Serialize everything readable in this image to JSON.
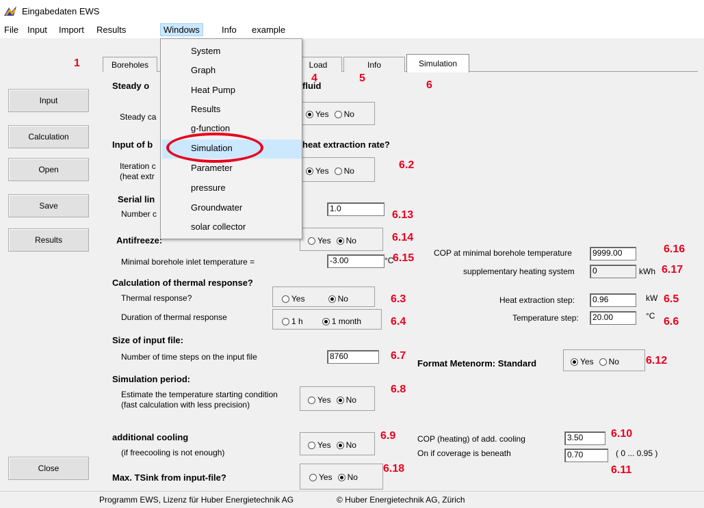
{
  "window": {
    "title": "Eingabedaten EWS"
  },
  "menubar": [
    "File",
    "Input",
    "Import",
    "Results",
    "Windows",
    "Info",
    "example"
  ],
  "windows_menu": [
    "System",
    "Graph",
    "Heat Pump",
    "Results",
    "g-function",
    "Simulation",
    "Parameter",
    "pressure",
    "Groundwater",
    "solar collector"
  ],
  "sidebar": {
    "input": "Input",
    "calculation": "Calculation",
    "open": "Open",
    "save": "Save",
    "results": "Results",
    "close": "Close"
  },
  "tabs": {
    "boreholes": "Boreholes",
    "load": "Load",
    "info": "Info",
    "simulation": "Simulation"
  },
  "annotations": {
    "n1": "1",
    "n4": "4",
    "n5": "5",
    "n6": "6",
    "a62": "6.2",
    "a613": "6.13",
    "a614": "6.14",
    "a615": "6.15",
    "a616": "6.16",
    "a617": "6.17",
    "a63": "6.3",
    "a64": "6.4",
    "a65": "6.5",
    "a66": "6.6",
    "a67": "6.7",
    "a612": "6.12",
    "a68": "6.8",
    "a69": "6.9",
    "a610": "6.10",
    "a611": "6.11",
    "a618": "6.18"
  },
  "simulation": {
    "steady_heading_left": "Steady o",
    "steady_heading_right": "fluid",
    "steady_label": "Steady ca",
    "input_heading_left": "Input of b",
    "input_heading_right": "heat extraction rate?",
    "iteration_label_1": "Iteration c",
    "iteration_label_2": "(heat extr",
    "serial_heading": "Serial lin",
    "number_label": "Number c",
    "number_value": "1.0",
    "antifreeze_heading": "Antifreeze:",
    "min_inlet_label": "Minimal borehole inlet temperature =",
    "min_inlet_value": "-3.00",
    "min_inlet_unit": "°C",
    "cop_min_label": "COP at minimal borehole temperature",
    "cop_min_value": "9999.00",
    "supp_label": "supplementary heating system",
    "supp_value": "0",
    "supp_unit": "kWh",
    "thermal_heading": "Calculation of thermal response?",
    "thermal_label": "Thermal response?",
    "duration_label": "Duration of thermal response",
    "opt_1h": "1 h",
    "opt_1month": "1 month",
    "heat_step_label": "Heat extraction step:",
    "heat_step_value": "0.96",
    "heat_step_unit": "kW",
    "temp_step_label": "Temperature step:",
    "temp_step_value": "20.00",
    "temp_step_unit": "°C",
    "size_heading": "Size of input file:",
    "steps_label": "Number of time steps on the input file",
    "steps_value": "8760",
    "metenorm_label": "Format Metenorm: Standard",
    "sim_period_heading": "Simulation period:",
    "estimate_label_1": "Estimate the temperature starting condition",
    "estimate_label_2": "(fast calculation with less precision)",
    "cooling_heading": "additional cooling",
    "cooling_sub": "(if freecooling is not enough)",
    "cop_heating_label": "COP (heating) of add. cooling",
    "cop_heating_value": "3.50",
    "coverage_label": "On if coverage is beneath",
    "coverage_value": "0.70",
    "coverage_range": "( 0 ... 0.95 )",
    "tsink_heading": "Max. TSink from input-file?",
    "yes": "Yes",
    "no": "No"
  },
  "status": {
    "left": "Programm EWS, Lizenz für Huber Energietechnik AG",
    "right": "© Huber Energietechnik AG, Zürich"
  },
  "colors": {
    "annotation": "#e8001c",
    "menu_highlight": "#cce8ff"
  }
}
